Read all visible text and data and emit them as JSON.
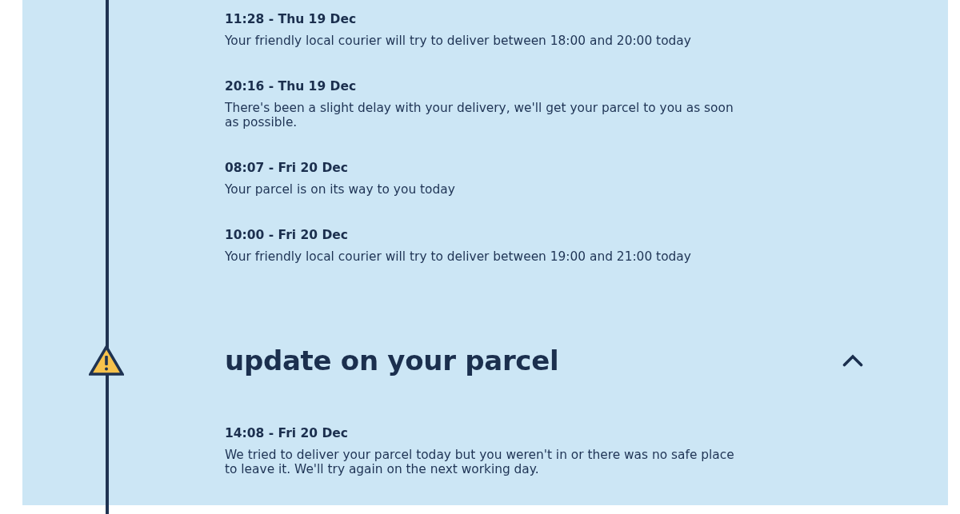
{
  "events": [
    {
      "time": "11:28 - Thu 19 Dec",
      "message": "Your friendly local courier will try to deliver between 18:00 and 20:00 today"
    },
    {
      "time": "20:16 - Thu 19 Dec",
      "message": "There's been a slight delay with your delivery, we'll get your parcel to you as soon as possible."
    },
    {
      "time": "08:07 - Fri 20 Dec",
      "message": "Your parcel is on its way to you today"
    },
    {
      "time": "10:00 - Fri 20 Dec",
      "message": "Your friendly local courier will try to deliver between 19:00 and 21:00 today"
    }
  ],
  "sections": [
    {
      "kind": "warning",
      "title": "update on your parcel",
      "expanded": true,
      "events": [
        {
          "time": "14:08 - Fri 20 Dec",
          "message": "We tried to deliver your parcel today but you weren't in or there was no safe place to leave it. We'll try again on the next working day."
        }
      ]
    }
  ]
}
